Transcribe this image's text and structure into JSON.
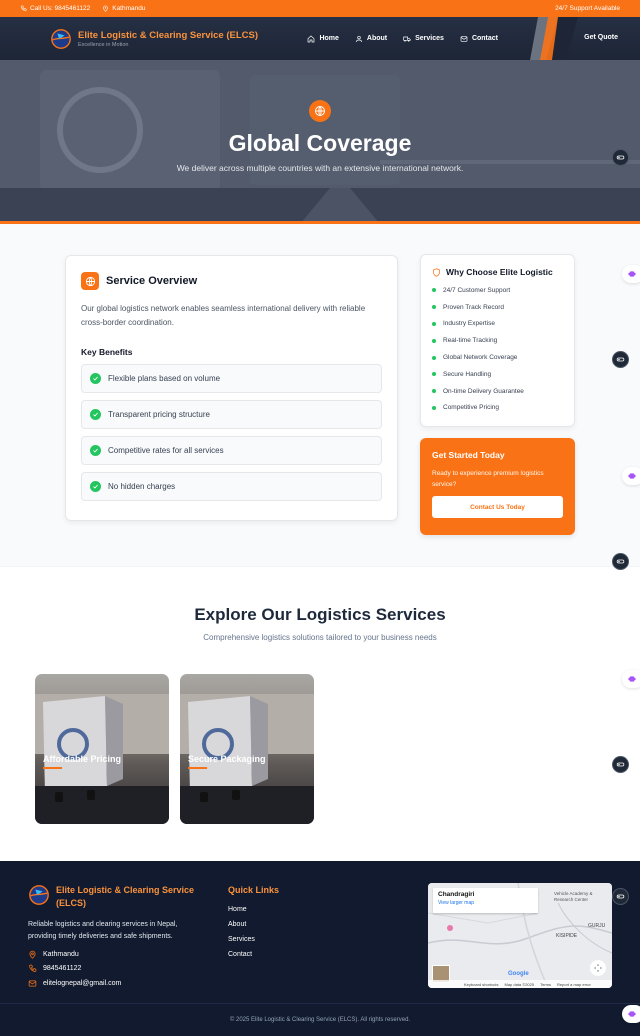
{
  "topbar": {
    "phone": "Call Us: 9845461122",
    "location": "Kathmandu",
    "support": "24/7 Support Available"
  },
  "header": {
    "brand_name": "Elite Logistic & Clearing Service (ELCS)",
    "tagline": "Excellence in Motion",
    "nav": [
      "Home",
      "About",
      "Services",
      "Contact"
    ],
    "cta": "Get Quote"
  },
  "hero": {
    "title": "Global Coverage",
    "subtitle": "We deliver across multiple countries with an extensive international network."
  },
  "overview": {
    "title": "Service Overview",
    "description": "Our global logistics network enables seamless international delivery with reliable cross-border coordination.",
    "benefits_title": "Key Benefits",
    "benefits": [
      "Flexible plans based on volume",
      "Transparent pricing structure",
      "Competitive rates for all services",
      "No hidden charges"
    ]
  },
  "why": {
    "title": "Why Choose Elite Logistic",
    "items": [
      "24/7 Customer Support",
      "Proven Track Record",
      "Industry Expertise",
      "Real-time Tracking",
      "Global Network Coverage",
      "Secure Handling",
      "On-time Delivery Guarantee",
      "Competitive Pricing"
    ]
  },
  "cta": {
    "title": "Get Started Today",
    "text": "Ready to experience premium logistics service?",
    "button": "Contact Us Today"
  },
  "explore": {
    "title": "Explore Our Logistics Services",
    "subtitle": "Comprehensive logistics solutions tailored to your business needs",
    "cards": [
      "Affordable Pricing",
      "Secure Packaging"
    ]
  },
  "footer": {
    "brand_name": "Elite Logistic & Clearing Service (ELCS)",
    "description": "Reliable logistics and clearing services in Nepal, providing timely deliveries and safe shipments.",
    "location": "Kathmandu",
    "phone": "9845461122",
    "email": "elitelognepal@gmail.com",
    "quick_links_title": "Quick Links",
    "quick_links": [
      "Home",
      "About",
      "Services",
      "Contact"
    ],
    "map": {
      "place": "Chandragiri",
      "link": "View larger map",
      "labels": [
        "Vehicle Academy & Research Center",
        "KISIPIDE",
        "GURJU"
      ],
      "footer": [
        "Keyboard shortcuts",
        "Map data ©2025",
        "Terms",
        "Report a map error"
      ],
      "brand": "Google"
    },
    "copyright": "© 2025 Elite Logistic & Clearing Service (ELCS). All rights reserved."
  },
  "colors": {
    "accent": "#f97316",
    "navy": "#111a2e",
    "success": "#22c55e"
  }
}
